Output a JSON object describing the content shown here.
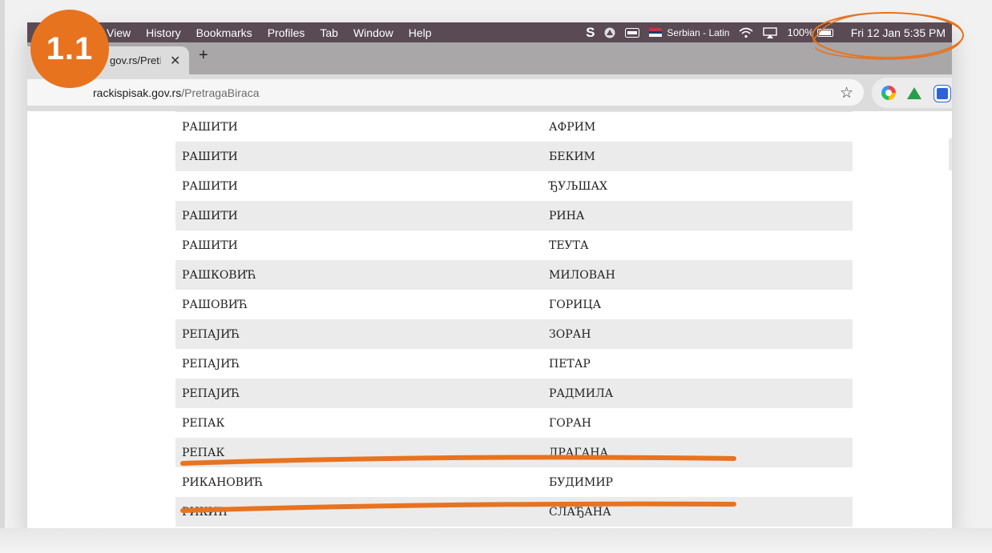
{
  "badge": {
    "label": "1.1"
  },
  "menubar": {
    "items": [
      "View",
      "History",
      "Bookmarks",
      "Profiles",
      "Tab",
      "Window",
      "Help"
    ],
    "status": {
      "skype": "S",
      "language": "Serbian - Latin",
      "battery_percent": "100%",
      "datetime": "Fri 12 Jan  5:35 PM"
    }
  },
  "tab": {
    "title_visible": "gov.rs/Pret",
    "title_fade": "i",
    "close": "✕",
    "new_tab": "+"
  },
  "address": {
    "host": "rackispisak.gov.rs",
    "path": "/PretragaBiraca",
    "star": "☆"
  },
  "table": {
    "rows": [
      {
        "last": "РАШИТИ",
        "first": "АФРИМ"
      },
      {
        "last": "РАШИТИ",
        "first": "БЕКИМ"
      },
      {
        "last": "РАШИТИ",
        "first": "ЂУЉШАХ"
      },
      {
        "last": "РАШИТИ",
        "first": "РИНА"
      },
      {
        "last": "РАШИТИ",
        "first": "ТЕУТА"
      },
      {
        "last": "РАШКОВИЋ",
        "first": "МИЛОВАН"
      },
      {
        "last": "РАШОВИЋ",
        "first": "ГОРИЦА"
      },
      {
        "last": "РЕПАЈИЋ",
        "first": "ЗОРАН"
      },
      {
        "last": "РЕПАЈИЋ",
        "first": "ПЕТАР"
      },
      {
        "last": "РЕПАЈИЋ",
        "first": "РАДМИЛА"
      },
      {
        "last": "РЕПАК",
        "first": "ГОРАН"
      },
      {
        "last": "РЕПАК",
        "first": "ДРАГАНА"
      },
      {
        "last": "РИКАНОВИЋ",
        "first": "БУДИМИР"
      },
      {
        "last": "РИКИЋ",
        "first": "СЛАЂАНА"
      }
    ]
  },
  "colors": {
    "annotation": "#e8731f",
    "menubar": "#5a4a53",
    "row_alt": "#ebebeb"
  }
}
